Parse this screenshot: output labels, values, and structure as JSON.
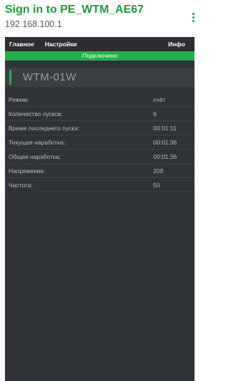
{
  "header": {
    "title": "Sign in to PE_WTM_AE67",
    "subtitle": "192.168.100.1"
  },
  "nav": {
    "items": [
      {
        "label": "Главное"
      },
      {
        "label": "Настройки"
      },
      {
        "label": "Инфо"
      }
    ]
  },
  "status": {
    "text": "Подключено"
  },
  "device": {
    "name": "WTM-01W"
  },
  "params": [
    {
      "label": "Режим:",
      "value": "счёт"
    },
    {
      "label": "Количество пусков:",
      "value": "6"
    },
    {
      "label": "Время последнего пуска:",
      "value": "00:01:11"
    },
    {
      "label": "Текущая наработка:",
      "value": "00:01:36"
    },
    {
      "label": "Общая наработка:",
      "value": "00:01:36"
    },
    {
      "label": "Напряжение:",
      "value": "208"
    },
    {
      "label": "Частота:",
      "value": "50"
    }
  ],
  "colors": {
    "accent": "#1e9a3b",
    "status_bar": "#22b14c",
    "panel": "#2f3236"
  },
  "icons": {
    "menu": "more-vert-icon"
  }
}
